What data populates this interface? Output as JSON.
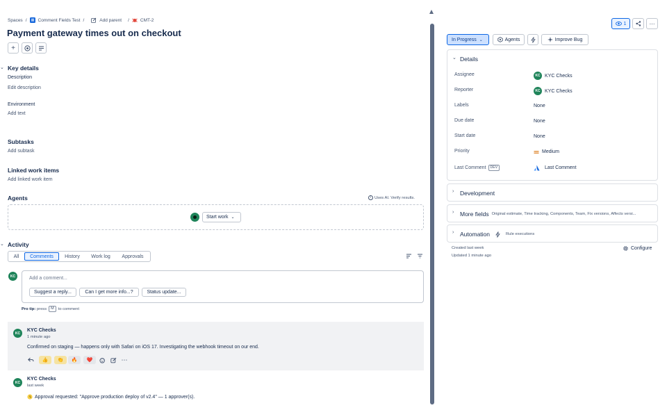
{
  "breadcrumb": {
    "spaces": "Spaces",
    "project": "Comment Fields Test",
    "add_parent": "Add parent",
    "issue_key": "CMT-2"
  },
  "issue": {
    "title": "Payment gateway times out on checkout"
  },
  "key_details": {
    "heading": "Key details",
    "description_label": "Description",
    "description_placeholder": "Edit description",
    "environment_label": "Environment",
    "environment_placeholder": "Add text"
  },
  "subtasks": {
    "heading": "Subtasks",
    "add": "Add subtask"
  },
  "linked": {
    "heading": "Linked work items",
    "add": "Add linked work item"
  },
  "agents": {
    "heading": "Agents",
    "ai_note": "Uses AI. Verify results.",
    "start_work": "Start work"
  },
  "activity": {
    "heading": "Activity",
    "tabs": [
      "All",
      "Comments",
      "History",
      "Work log",
      "Approvals"
    ],
    "active_tab": "Comments"
  },
  "comment_box": {
    "avatar": "KC",
    "placeholder": "Add a comment...",
    "chips": [
      "Suggest a reply...",
      "Can I get more info...?",
      "Status update..."
    ],
    "protip_bold": "Pro tip:",
    "protip_pre": "press",
    "protip_key": "M",
    "protip_post": "to comment"
  },
  "comments": [
    {
      "author": "KYC Checks",
      "initials": "KC",
      "time": "1 minute ago",
      "text": "Confirmed on staging — happens only with Safari on iOS 17. Investigating the webhook timeout on our end.",
      "reactions": [
        "👍",
        "👏",
        "🔥",
        "❤️"
      ]
    },
    {
      "author": "KYC Checks",
      "initials": "KC",
      "time": "last week",
      "text": "Approval requested: \"Approve production deploy of v2.4\" — 1 approver(s)."
    }
  ],
  "sidebar": {
    "watch_count": "1",
    "status": "In Progress",
    "agents_btn": "Agents",
    "improve_btn": "Improve Bug",
    "details": {
      "title": "Details",
      "fields": [
        {
          "label": "Assignee",
          "value": "KYC Checks",
          "avatar": "KC"
        },
        {
          "label": "Reporter",
          "value": "KYC Checks",
          "avatar": "KC"
        },
        {
          "label": "Labels",
          "value": "None"
        },
        {
          "label": "Due date",
          "value": "None"
        },
        {
          "label": "Start date",
          "value": "None"
        },
        {
          "label": "Priority",
          "value": "Medium"
        },
        {
          "label": "Last Comment",
          "tag": "DEV",
          "value": "Last Comment"
        }
      ]
    },
    "development": "Development",
    "more_fields": "More fields",
    "more_fields_sub": "Original estimate, Time tracking, Components, Team, Fix versions, Affects versi...",
    "automation": "Automation",
    "automation_sub": "Rule executions",
    "created": "Created last week",
    "updated": "Updated 1 minute ago",
    "configure": "Configure"
  },
  "colors": {
    "accent": "#0c66e4",
    "avatar": "#1f845a",
    "status_bg": "#cce0ff"
  }
}
